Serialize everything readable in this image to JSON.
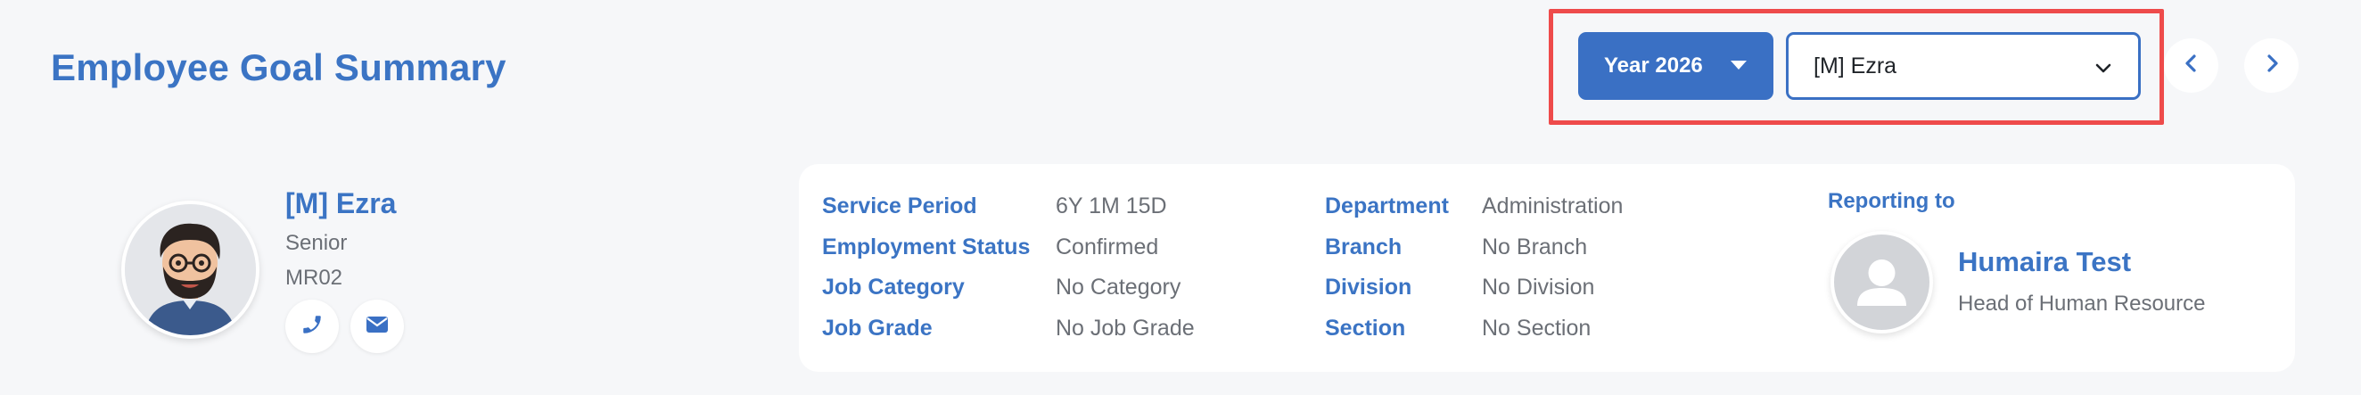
{
  "header": {
    "title": "Employee Goal Summary",
    "year_button_label": "Year 2026",
    "employee_select_value": "[M] Ezra",
    "prev_icon": "chevron-left-icon",
    "next_icon": "chevron-right-icon"
  },
  "employee": {
    "name": "[M] Ezra",
    "level": "Senior",
    "code": "MR02",
    "contact_icons": [
      "phone-icon",
      "mail-icon"
    ]
  },
  "details": {
    "left": [
      {
        "label": "Service Period",
        "value": "6Y 1M 15D"
      },
      {
        "label": "Employment Status",
        "value": "Confirmed"
      },
      {
        "label": "Job Category",
        "value": "No Category"
      },
      {
        "label": "Job Grade",
        "value": "No Job Grade"
      }
    ],
    "right": [
      {
        "label": "Department",
        "value": "Administration"
      },
      {
        "label": "Branch",
        "value": "No Branch"
      },
      {
        "label": "Division",
        "value": "No Division"
      },
      {
        "label": "Section",
        "value": "No Section"
      }
    ]
  },
  "reporting": {
    "label": "Reporting to",
    "manager_name": "Humaira Test",
    "manager_title": "Head of Human Resource"
  },
  "colors": {
    "accent": "#3a70c4",
    "highlight": "#ee4b4b",
    "muted_text": "#6b6f76",
    "background": "#f6f7f9"
  }
}
